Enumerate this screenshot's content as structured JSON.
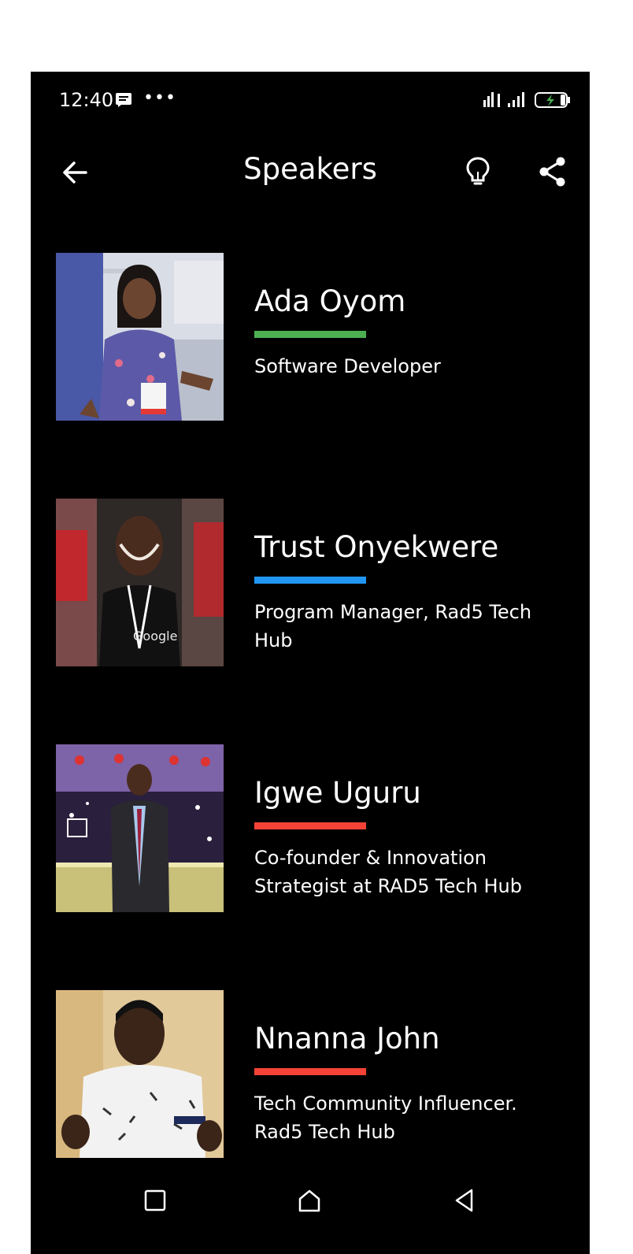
{
  "status_bar": {
    "time": "12:40",
    "icons": [
      "message-icon",
      "more-dots-icon",
      "signal-icon",
      "battery-charging-icon"
    ]
  },
  "app_bar": {
    "title": "Speakers",
    "icons": [
      "back-arrow-icon",
      "lightbulb-icon",
      "share-icon"
    ]
  },
  "speakers": [
    {
      "name": "Ada Oyom",
      "title": "Software Developer",
      "accent_color": "#4caf50"
    },
    {
      "name": "Trust Onyekwere",
      "title": "Program Manager, Rad5 Tech Hub",
      "accent_color": "#2196f3"
    },
    {
      "name": "Igwe Uguru",
      "title": "Co-founder & Innovation Strategist at RAD5 Tech Hub",
      "accent_color": "#f44336"
    },
    {
      "name": "Nnanna John",
      "title": "Tech Community Influencer. Rad5 Tech Hub",
      "accent_color": "#f44336"
    }
  ],
  "nav_bar": {
    "icons": [
      "recents-square-icon",
      "home-icon",
      "back-triangle-icon"
    ]
  },
  "colors": {
    "background": "#000000",
    "page_margin": "#ffffff",
    "text": "#ffffff"
  }
}
